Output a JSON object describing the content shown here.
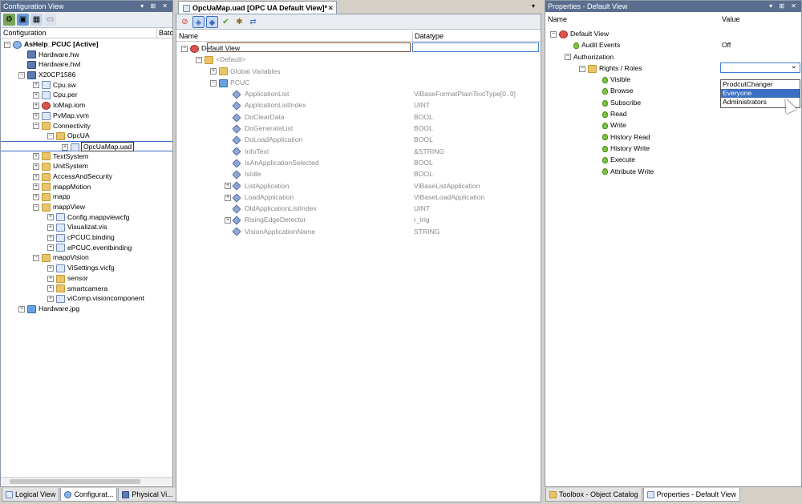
{
  "left_pane": {
    "title": "Configuration View",
    "controls": "▾ ⊞ ✕",
    "columns": {
      "name": "Configuration",
      "batch": "Batc"
    },
    "tree": [
      {
        "level": 0,
        "label": "AsHelp_PCUC [Active]",
        "icon": "project-icon",
        "exp": "-",
        "bold": true
      },
      {
        "level": 1,
        "label": "Hardware.hw",
        "icon": "hardware-icon"
      },
      {
        "level": 1,
        "label": "Hardware.hwl",
        "icon": "hardware-icon"
      },
      {
        "level": 1,
        "label": "X20CP1586",
        "icon": "cpu-icon",
        "exp": "-"
      },
      {
        "level": 2,
        "label": "Cpu.sw",
        "icon": "file-icon",
        "exp": "+"
      },
      {
        "level": 2,
        "label": "Cpu.per",
        "icon": "file-icon",
        "exp": "+"
      },
      {
        "level": 2,
        "label": "IoMap.iom",
        "icon": "iomap-icon",
        "exp": "+"
      },
      {
        "level": 2,
        "label": "PvMap.vvm",
        "icon": "file-icon",
        "exp": "+"
      },
      {
        "level": 2,
        "label": "Connectivity",
        "icon": "folder-icon",
        "exp": "-"
      },
      {
        "level": 3,
        "label": "OpcUA",
        "icon": "folder-icon",
        "exp": "-"
      },
      {
        "level": 4,
        "label": "OpcUaMap.uad",
        "icon": "file-icon",
        "exp": "+",
        "selected": true
      },
      {
        "level": 2,
        "label": "TextSystem",
        "icon": "folder-icon",
        "exp": "+"
      },
      {
        "level": 2,
        "label": "UnitSystem",
        "icon": "folder-icon",
        "exp": "+"
      },
      {
        "level": 2,
        "label": "AccessAndSecurity",
        "icon": "folder-icon",
        "exp": "+"
      },
      {
        "level": 2,
        "label": "mappMotion",
        "icon": "folder-icon",
        "exp": "+"
      },
      {
        "level": 2,
        "label": "mapp",
        "icon": "folder-icon",
        "exp": "+"
      },
      {
        "level": 2,
        "label": "mappView",
        "icon": "folder-icon",
        "exp": "-"
      },
      {
        "level": 3,
        "label": "Config.mappviewcfg",
        "icon": "file-icon",
        "exp": "+"
      },
      {
        "level": 3,
        "label": "Visualizat.vis",
        "icon": "file-icon",
        "exp": "+"
      },
      {
        "level": 3,
        "label": "cPCUC.binding",
        "icon": "file-icon",
        "exp": "+"
      },
      {
        "level": 3,
        "label": "ePCUC.eventbinding",
        "icon": "file-icon",
        "exp": "+"
      },
      {
        "level": 2,
        "label": "mappVision",
        "icon": "folder-icon",
        "exp": "-"
      },
      {
        "level": 3,
        "label": "ViSettings.vicfg",
        "icon": "gear-icon",
        "exp": "+"
      },
      {
        "level": 3,
        "label": "sensor",
        "icon": "folder-icon",
        "exp": "+"
      },
      {
        "level": 3,
        "label": "smartcamera",
        "icon": "folder-icon",
        "exp": "+"
      },
      {
        "level": 3,
        "label": "viComp.visioncomponent",
        "icon": "file-icon",
        "exp": "+"
      },
      {
        "level": 1,
        "label": "Hardware.jpg",
        "icon": "image-icon",
        "exp": "+"
      }
    ],
    "tabs": [
      "Logical View",
      "Configurat...",
      "Physical Vi..."
    ]
  },
  "editor": {
    "tab_title": "OpcUaMap.uad [OPC UA Default View]*",
    "columns": {
      "name": "Name",
      "datatype": "Datatype"
    },
    "rows": [
      {
        "level": 0,
        "label": "Default View",
        "type": "",
        "icon": "view-icon",
        "exp": "-",
        "edit": true
      },
      {
        "level": 1,
        "label": "<Default>",
        "type": "",
        "icon": "folder-icon",
        "exp": "-",
        "gray": true
      },
      {
        "level": 2,
        "label": "Global Variables",
        "type": "",
        "icon": "folder-icon",
        "exp": "+",
        "gray": true
      },
      {
        "level": 2,
        "label": "PCUC",
        "type": "",
        "icon": "cube-icon",
        "exp": "-",
        "gray": true
      },
      {
        "level": 3,
        "label": "ApplicationList",
        "type": "ViBaseFormatPlainTextType[0..9]",
        "icon": "variable-icon"
      },
      {
        "level": 3,
        "label": "ApplicationListIndex",
        "type": "UINT",
        "icon": "variable-icon"
      },
      {
        "level": 3,
        "label": "DoClearData",
        "type": "BOOL",
        "icon": "variable-icon"
      },
      {
        "level": 3,
        "label": "DoGenerateList",
        "type": "BOOL",
        "icon": "variable-icon"
      },
      {
        "level": 3,
        "label": "DoLoadApplication",
        "type": "BOOL",
        "icon": "variable-icon"
      },
      {
        "level": 3,
        "label": "InfoText",
        "type": "&STRING",
        "icon": "variable-icon"
      },
      {
        "level": 3,
        "label": "IsAnApplicationSelected",
        "type": "BOOL",
        "icon": "variable-icon"
      },
      {
        "level": 3,
        "label": "IsIdle",
        "type": "BOOL",
        "icon": "variable-icon"
      },
      {
        "level": 3,
        "label": "ListApplication",
        "type": "ViBaseListApplication",
        "icon": "variable-icon",
        "exp": "+"
      },
      {
        "level": 3,
        "label": "LoadApplication",
        "type": "ViBaseLoadApplication",
        "icon": "variable-icon",
        "exp": "+"
      },
      {
        "level": 3,
        "label": "OldApplicationListIndex",
        "type": "UINT",
        "icon": "variable-icon"
      },
      {
        "level": 3,
        "label": "RisingEdgeDetector",
        "type": "r_trig",
        "icon": "variable-icon",
        "exp": "+"
      },
      {
        "level": 3,
        "label": "VisionApplicationName",
        "type": "STRING",
        "icon": "variable-icon"
      }
    ]
  },
  "properties": {
    "title": "Properties - Default View",
    "controls": "▾ ⊞ ✕",
    "columns": {
      "name": "Name",
      "value": "Value"
    },
    "rows": [
      {
        "level": 0,
        "label": "Default View",
        "value": "",
        "icon": "view-icon",
        "exp": "-"
      },
      {
        "level": 1,
        "label": "Audit Events",
        "value": "Off",
        "icon": "bulb-icon"
      },
      {
        "level": 1,
        "label": "Authorization",
        "value": "",
        "icon": "none",
        "exp": "-"
      },
      {
        "level": 2,
        "label": "Rights / Roles",
        "value": "",
        "icon": "roles-icon",
        "exp": "-",
        "dropdown": true
      },
      {
        "level": 3,
        "label": "Visible",
        "value": "",
        "icon": "bulb-icon"
      },
      {
        "level": 3,
        "label": "Browse",
        "value": "",
        "icon": "bulb-icon"
      },
      {
        "level": 3,
        "label": "Subscribe",
        "value": "",
        "icon": "bulb-icon"
      },
      {
        "level": 3,
        "label": "Read",
        "value": "",
        "icon": "bulb-icon"
      },
      {
        "level": 3,
        "label": "Write",
        "value": "",
        "icon": "bulb-icon"
      },
      {
        "level": 3,
        "label": "History Read",
        "value": "",
        "icon": "bulb-icon"
      },
      {
        "level": 3,
        "label": "History Write",
        "value": "",
        "icon": "bulb-icon"
      },
      {
        "level": 3,
        "label": "Execute",
        "value": "",
        "icon": "bulb-icon"
      },
      {
        "level": 3,
        "label": "Attribute Write",
        "value": "",
        "icon": "bulb-icon"
      }
    ],
    "dropdown_options": [
      "ProdcutChanger",
      "Everyone",
      "Administrators"
    ],
    "dropdown_highlighted": 1,
    "tabs": [
      "Toolbox - Object Catalog",
      "Properties - Default View"
    ]
  },
  "colors": {
    "titlebar": "#5a6f8f",
    "selection": "#3c6fc2",
    "dropdown_border": "#3c7fd6"
  }
}
